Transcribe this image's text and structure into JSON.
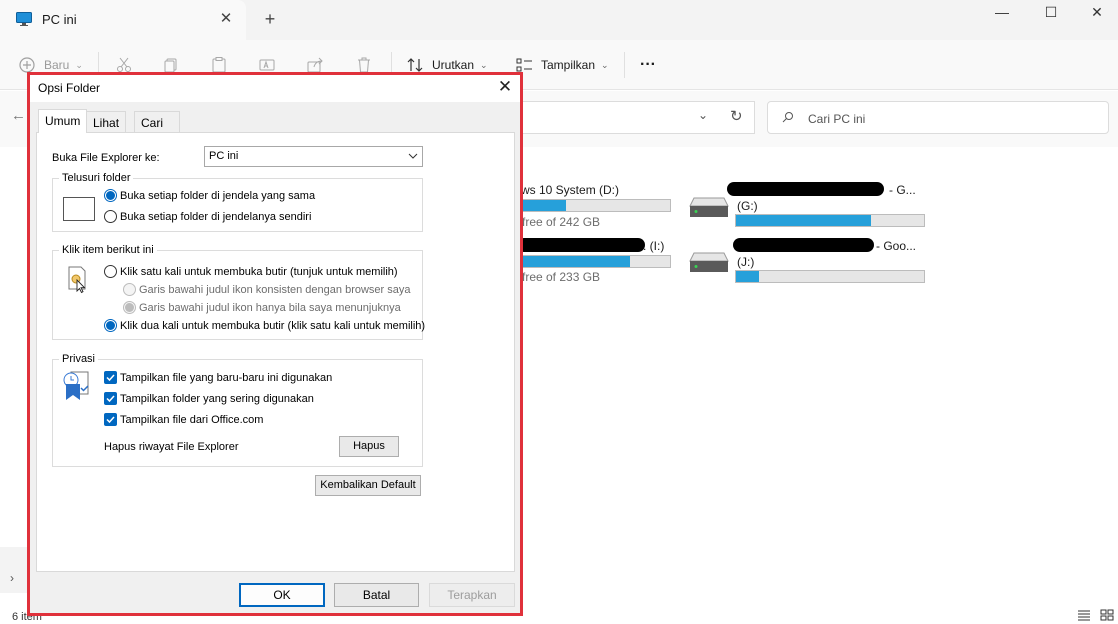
{
  "window": {
    "tab_title": "PC ini",
    "tab_close": "✕",
    "new_tab": "+",
    "minimize": "—",
    "maximize": "☐",
    "close": "✕"
  },
  "toolbar": {
    "new_label": "Baru",
    "sort_label": "Urutkan",
    "view_label": "Tampilkan",
    "more_label": "···"
  },
  "search": {
    "placeholder": "Cari PC ini"
  },
  "drives": [
    {
      "name": "ws 10 System (D:)",
      "free": "free of 242 GB",
      "used": 0.3
    },
    {
      "name": "- G...",
      "label": "(G:)",
      "used": 0.72
    },
    {
      "name": ". (I:)",
      "free": "free of 233 GB",
      "used": 0.73
    },
    {
      "name": "- Goo...",
      "label": "(J:)",
      "used": 0.12
    }
  ],
  "status": {
    "item_count": "6 item"
  },
  "dialog": {
    "title": "Opsi Folder",
    "close": "✕",
    "tabs": [
      "Umum",
      "Lihat",
      "Cari"
    ],
    "open_label": "Buka File Explorer ke:",
    "open_value": "PC ini",
    "browse": {
      "title": "Telusuri folder",
      "opt_same": "Buka setiap folder di jendela yang sama",
      "opt_own": "Buka setiap folder di jendelanya sendiri"
    },
    "click": {
      "title": "Klik item berikut ini",
      "single": "Klik satu kali untuk membuka butir (tunjuk untuk memilih)",
      "underline_always": "Garis bawahi judul ikon konsisten dengan browser saya",
      "underline_point": "Garis bawahi judul ikon hanya bila saya menunjuknya",
      "double": "Klik dua kali untuk membuka butir (klik satu kali untuk memilih)"
    },
    "privacy": {
      "title": "Privasi",
      "recent_files": "Tampilkan file yang baru-baru ini digunakan",
      "frequent_folders": "Tampilkan folder yang sering digunakan",
      "office_files": "Tampilkan file dari Office.com",
      "clear_label": "Hapus riwayat File Explorer",
      "clear_button": "Hapus"
    },
    "restore_button": "Kembalikan Default",
    "ok": "OK",
    "cancel": "Batal",
    "apply": "Terapkan"
  },
  "colors": {
    "accent": "#0067c0",
    "highlight_border": "#e0313b",
    "drive_fill": "#26a0da"
  }
}
